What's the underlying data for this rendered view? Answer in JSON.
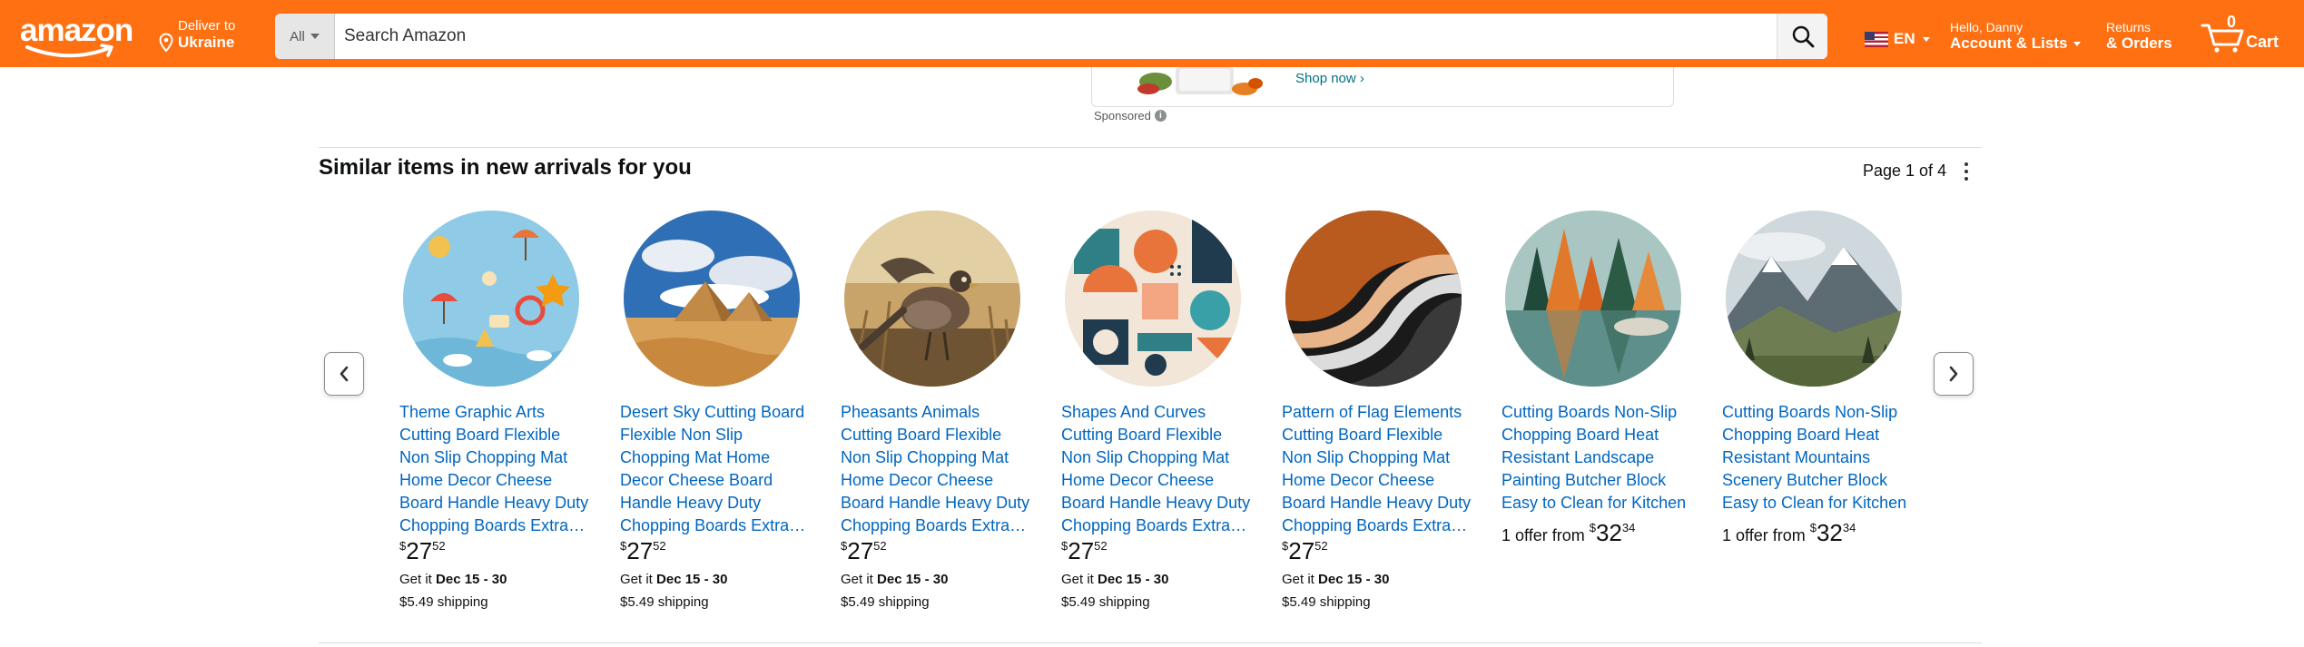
{
  "header": {
    "logo_text": "amazon",
    "deliver_line1": "Deliver to",
    "deliver_line2": "Ukraine",
    "search_category": "All",
    "search_placeholder": "Search Amazon",
    "language": "EN",
    "account_line1": "Hello, Danny",
    "account_line2": "Account & Lists",
    "orders_line1": "Returns",
    "orders_line2": "& Orders",
    "cart_count": "0",
    "cart_label": "Cart"
  },
  "ad": {
    "link": "Shop now ›",
    "sponsored": "Sponsored"
  },
  "carousel": {
    "title": "Similar items in new arrivals for you",
    "page_info": "Page 1 of 4",
    "items": [
      {
        "title": "Theme Graphic Arts Cutting Board Flexible Non Slip Chopping Mat Home Decor Cheese Board Handle Heavy Duty Chopping Boards Extra…",
        "price_dollar": "$",
        "price_whole": "27",
        "price_frac": "52",
        "delivery_prefix": "Get it",
        "delivery_dates": "Dec 15 - 30",
        "shipping": "$5.49 shipping",
        "image": "beach-pattern"
      },
      {
        "title": "Desert Sky Cutting Board Flexible Non Slip Chopping Mat Home Decor Cheese Board Handle Heavy Duty Chopping Boards Extra…",
        "price_dollar": "$",
        "price_whole": "27",
        "price_frac": "52",
        "delivery_prefix": "Get it",
        "delivery_dates": "Dec 15 - 30",
        "shipping": "$5.49 shipping",
        "image": "desert-pyramids"
      },
      {
        "title": "Pheasants Animals Cutting Board Flexible Non Slip Chopping Mat Home Decor Cheese Board Handle Heavy Duty Chopping Boards Extra…",
        "price_dollar": "$",
        "price_whole": "27",
        "price_frac": "52",
        "delivery_prefix": "Get it",
        "delivery_dates": "Dec 15 - 30",
        "shipping": "$5.49 shipping",
        "image": "pheasant-bird"
      },
      {
        "title": "Shapes And Curves Cutting Board Flexible Non Slip Chopping Mat Home Decor Cheese Board Handle Heavy Duty Chopping Boards Extra…",
        "price_dollar": "$",
        "price_whole": "27",
        "price_frac": "52",
        "delivery_prefix": "Get it",
        "delivery_dates": "Dec 15 - 30",
        "shipping": "$5.49 shipping",
        "image": "geometric-shapes"
      },
      {
        "title": "Pattern of Flag Elements Cutting Board Flexible Non Slip Chopping Mat Home Decor Cheese Board Handle Heavy Duty Chopping Boards Extra…",
        "price_dollar": "$",
        "price_whole": "27",
        "price_frac": "52",
        "delivery_prefix": "Get it",
        "delivery_dates": "Dec 15 - 30",
        "shipping": "$5.49 shipping",
        "image": "orange-waves"
      },
      {
        "title": "Cutting Boards Non-Slip Chopping Board Heat Resistant Landscape Painting Butcher Block Easy to Clean for Kitchen",
        "offer_prefix": "1 offer from",
        "price_dollar": "$",
        "price_whole": "32",
        "price_frac": "34",
        "image": "autumn-lake"
      },
      {
        "title": "Cutting Boards Non-Slip Chopping Board Heat Resistant Mountains Scenery Butcher Block Easy to Clean for Kitchen",
        "offer_prefix": "1 offer from",
        "price_dollar": "$",
        "price_whole": "32",
        "price_frac": "34",
        "image": "mountain-scenery"
      }
    ]
  }
}
